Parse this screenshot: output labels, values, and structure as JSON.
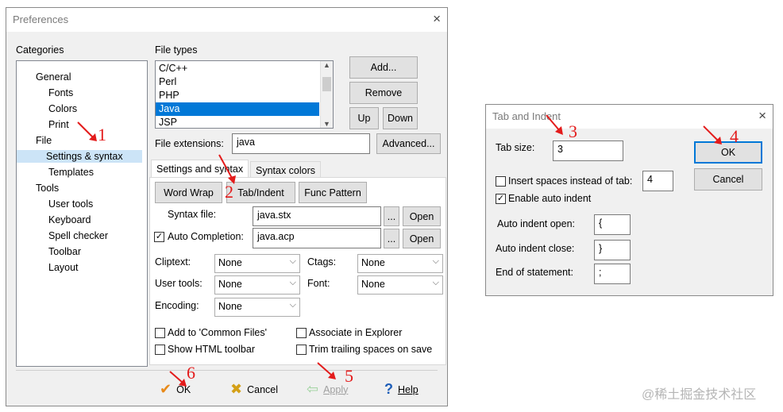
{
  "prefs": {
    "title": "Preferences",
    "close_glyph": "×",
    "categories_label": "Categories",
    "tree": [
      {
        "label": "General"
      },
      {
        "label": "Fonts"
      },
      {
        "label": "Colors"
      },
      {
        "label": "Print"
      },
      {
        "label": "File"
      },
      {
        "label": "Settings & syntax",
        "selected": true
      },
      {
        "label": "Templates"
      },
      {
        "label": "Tools"
      },
      {
        "label": "User tools"
      },
      {
        "label": "Keyboard"
      },
      {
        "label": "Spell checker"
      },
      {
        "label": "Toolbar"
      },
      {
        "label": "Layout"
      }
    ],
    "file_types_label": "File types",
    "file_types": [
      "C/C++",
      "Perl",
      "PHP",
      "Java",
      "JSP"
    ],
    "selected_file_type": "Java",
    "add_label": "Add...",
    "remove_label": "Remove",
    "up_label": "Up",
    "down_label": "Down",
    "file_ext_label": "File extensions:",
    "file_ext_value": "java",
    "advanced_label": "Advanced...",
    "tabs": {
      "settings": "Settings and syntax",
      "colors": "Syntax colors"
    },
    "word_wrap_label": "Word Wrap",
    "tab_indent_label": "Tab/Indent",
    "func_pattern_label": "Func Pattern",
    "syntax_file_label": "Syntax file:",
    "syntax_file_value": "java.stx",
    "auto_completion_label": "Auto Completion:",
    "auto_completion_checked": true,
    "auto_completion_value": "java.acp",
    "browse_label": "...",
    "open_label": "Open",
    "cliptext_label": "Cliptext:",
    "cliptext_value": "None",
    "ctags_label": "Ctags:",
    "ctags_value": "None",
    "user_tools_label": "User tools:",
    "user_tools_value": "None",
    "font_label": "Font:",
    "font_value": "None",
    "encoding_label": "Encoding:",
    "encoding_value": "None",
    "common_files_label": "Add to 'Common Files'",
    "associate_label": "Associate in Explorer",
    "html_toolbar_label": "Show HTML toolbar",
    "trim_label": "Trim trailing spaces on save",
    "ok_label": "OK",
    "cancel_label": "Cancel",
    "apply_label": "Apply",
    "help_label": "Help"
  },
  "tab_indent": {
    "title": "Tab and Indent",
    "close_glyph": "×",
    "tab_size_label": "Tab size:",
    "tab_size_value": "3",
    "insert_spaces_label": "Insert spaces instead of tab:",
    "insert_spaces_checked": false,
    "insert_spaces_value": "4",
    "auto_indent_label": "Enable auto indent",
    "auto_indent_checked": true,
    "indent_open_label": "Auto indent open:",
    "indent_open_value": "{",
    "indent_close_label": "Auto indent close:",
    "indent_close_value": "}",
    "end_statement_label": "End of statement:",
    "end_statement_value": ";",
    "ok_label": "OK",
    "cancel_label": "Cancel"
  },
  "annotations": [
    "1",
    "2",
    "3",
    "4",
    "5",
    "6"
  ],
  "watermark": "@稀土掘金技术社区",
  "colors": {
    "annotation": "#e31b1b",
    "selection": "#0078d7",
    "window_bg": "#f0f0f0"
  },
  "icons": {
    "ok": "check-icon",
    "cancel": "x-icon",
    "apply": "arrow-left-icon",
    "help": "question-icon"
  }
}
